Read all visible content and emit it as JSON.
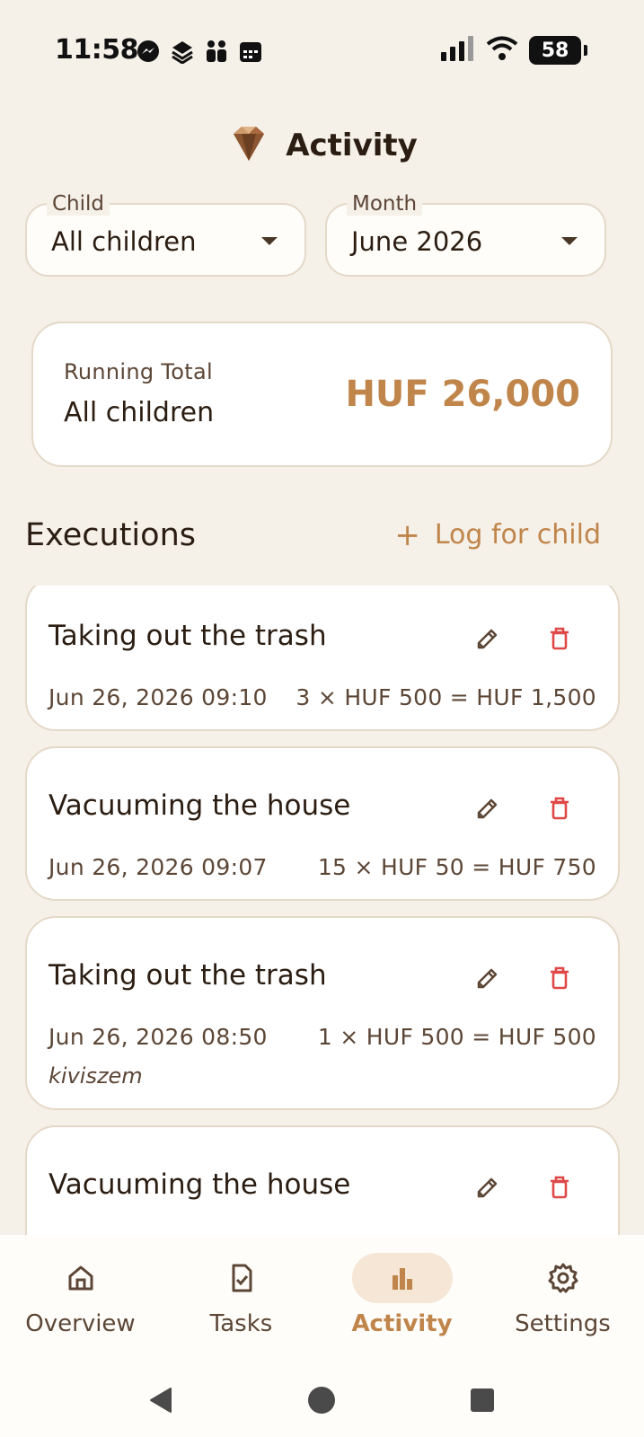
{
  "status_bar": {
    "time": "11:58",
    "notification_icons": [
      "messenger-icon",
      "stack-icon",
      "people-icon",
      "calendar-icon"
    ],
    "battery": "58"
  },
  "header": {
    "title": "Activity",
    "logo": "gem-logo"
  },
  "filters": {
    "child": {
      "label": "Child",
      "value": "All children"
    },
    "month": {
      "label": "Month",
      "value": "June 2026"
    }
  },
  "running_total": {
    "label": "Running Total",
    "scope": "All children",
    "amount": "HUF 26,000"
  },
  "executions": {
    "title": "Executions",
    "log_button": "Log for child",
    "items": [
      {
        "task": "Taking out the trash",
        "datetime": "Jun 26, 2026 09:10",
        "calc": "3 × HUF 500 = HUF 1,500",
        "note": ""
      },
      {
        "task": "Vacuuming the house",
        "datetime": "Jun 26, 2026 09:07",
        "calc": "15 × HUF 50 = HUF 750",
        "note": ""
      },
      {
        "task": "Taking out the trash",
        "datetime": "Jun 26, 2026 08:50",
        "calc": "1 × HUF 500 = HUF 500",
        "note": "kiviszem"
      },
      {
        "task": "Vacuuming the house",
        "datetime": "",
        "calc": "",
        "note": ""
      }
    ]
  },
  "bottom_nav": {
    "items": [
      {
        "label": "Overview",
        "icon": "home-icon",
        "active": false
      },
      {
        "label": "Tasks",
        "icon": "checklist-icon",
        "active": false
      },
      {
        "label": "Activity",
        "icon": "bar-chart-icon",
        "active": true
      },
      {
        "label": "Settings",
        "icon": "gear-icon",
        "active": false
      }
    ]
  },
  "colors": {
    "background": "#f5f0e8",
    "accent": "#c0854a",
    "danger": "#e04848",
    "text": "#2b1d12"
  }
}
